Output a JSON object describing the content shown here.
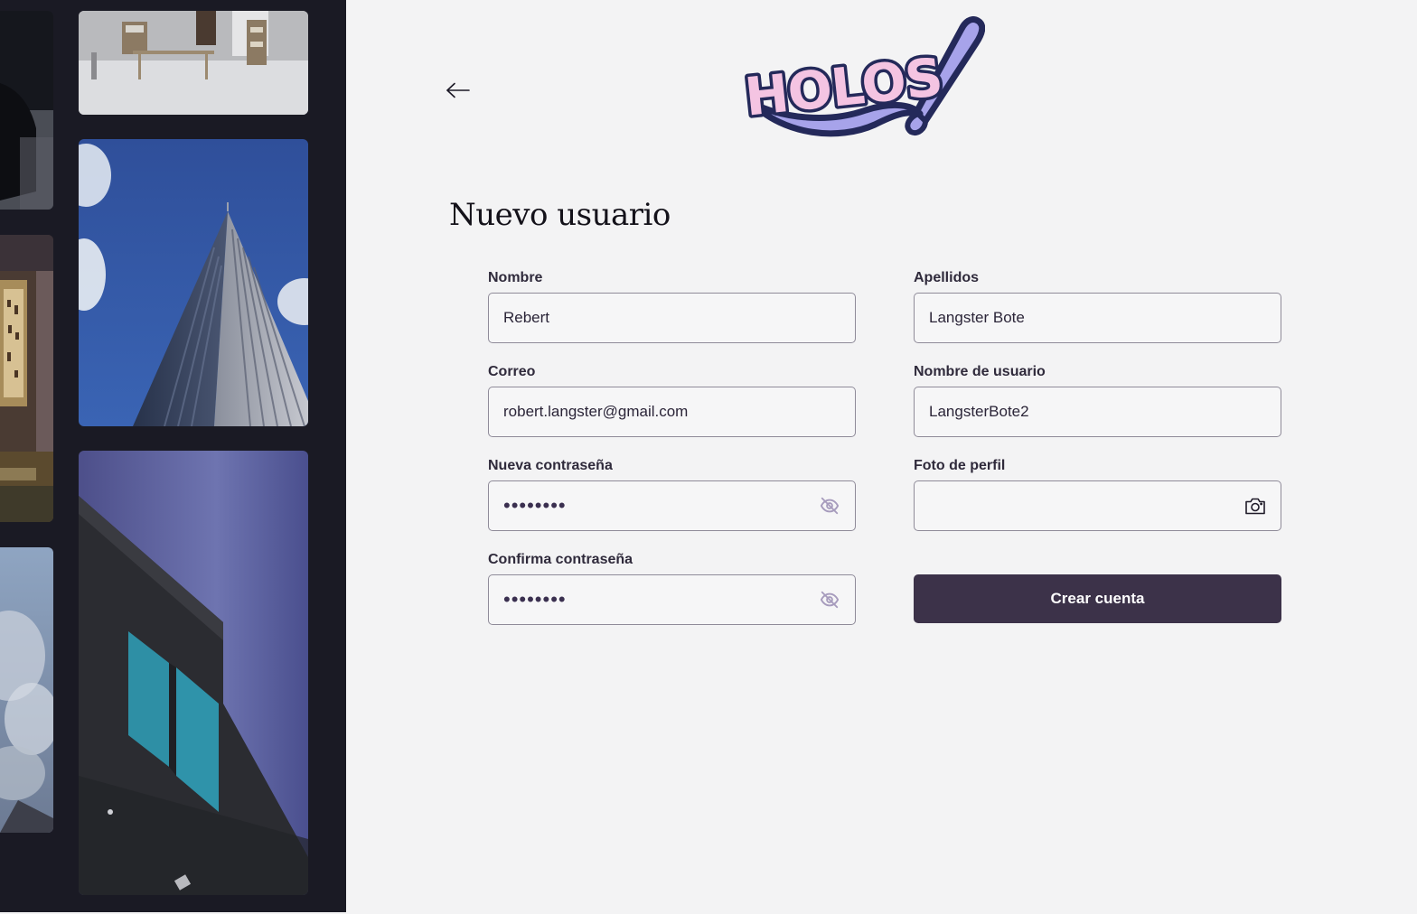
{
  "header": {
    "back_icon": "arrow-left-icon",
    "logo_text": "HOLOS"
  },
  "form": {
    "title": "Nuevo usuario",
    "fields": {
      "nombre": {
        "label": "Nombre",
        "value": "Rebert"
      },
      "apellidos": {
        "label": "Apellidos",
        "value": "Langster Bote"
      },
      "correo": {
        "label": "Correo",
        "value": "robert.langster@gmail.com"
      },
      "usuario": {
        "label": "Nombre de usuario",
        "value": "LangsterBote2"
      },
      "password": {
        "label": "Nueva contraseña",
        "value": "••••••••",
        "icon": "eye-off-icon"
      },
      "foto": {
        "label": "Foto de perfil",
        "value": "",
        "icon": "camera-icon"
      },
      "confirm": {
        "label": "Confirma contraseña",
        "value": "••••••••",
        "icon": "eye-off-icon"
      }
    },
    "submit_label": "Crear cuenta"
  },
  "gallery": {
    "images": [
      "interior-photo",
      "wall-scroll-photo",
      "sky-photo",
      "room-photo",
      "skyscraper-photo",
      "building-facade-photo"
    ]
  },
  "colors": {
    "panel_bg": "#f3f3f4",
    "gallery_bg": "#1a1a24",
    "primary_button": "#3c3249",
    "logo_fill": "#f4c4e2",
    "logo_outline": "#24295a",
    "logo_accent": "#a7a3ea",
    "icon_muted": "#a79cbd"
  }
}
